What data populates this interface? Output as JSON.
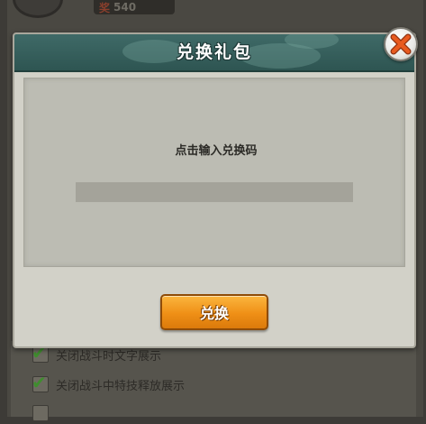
{
  "background": {
    "currency_value": "540",
    "currency_icon": "coin-icon",
    "options": [
      {
        "label": "关闭战斗时文字展示",
        "checked": true
      },
      {
        "label": "关闭战斗中特技释放展示",
        "checked": true
      },
      {
        "label": "",
        "checked": false
      }
    ]
  },
  "dialog": {
    "title": "兑换礼包",
    "instruction": "点击输入兑换码",
    "code_input": {
      "value": "",
      "placeholder": "点击输入兑换码"
    },
    "redeem_label": "兑换",
    "close_icon": "close-x-icon"
  },
  "colors": {
    "header": "#3f6a67",
    "button": "#ef8f16",
    "close_x": "#e85a1f",
    "panel": "#d2d1c8",
    "check": "#3f8d2e"
  }
}
